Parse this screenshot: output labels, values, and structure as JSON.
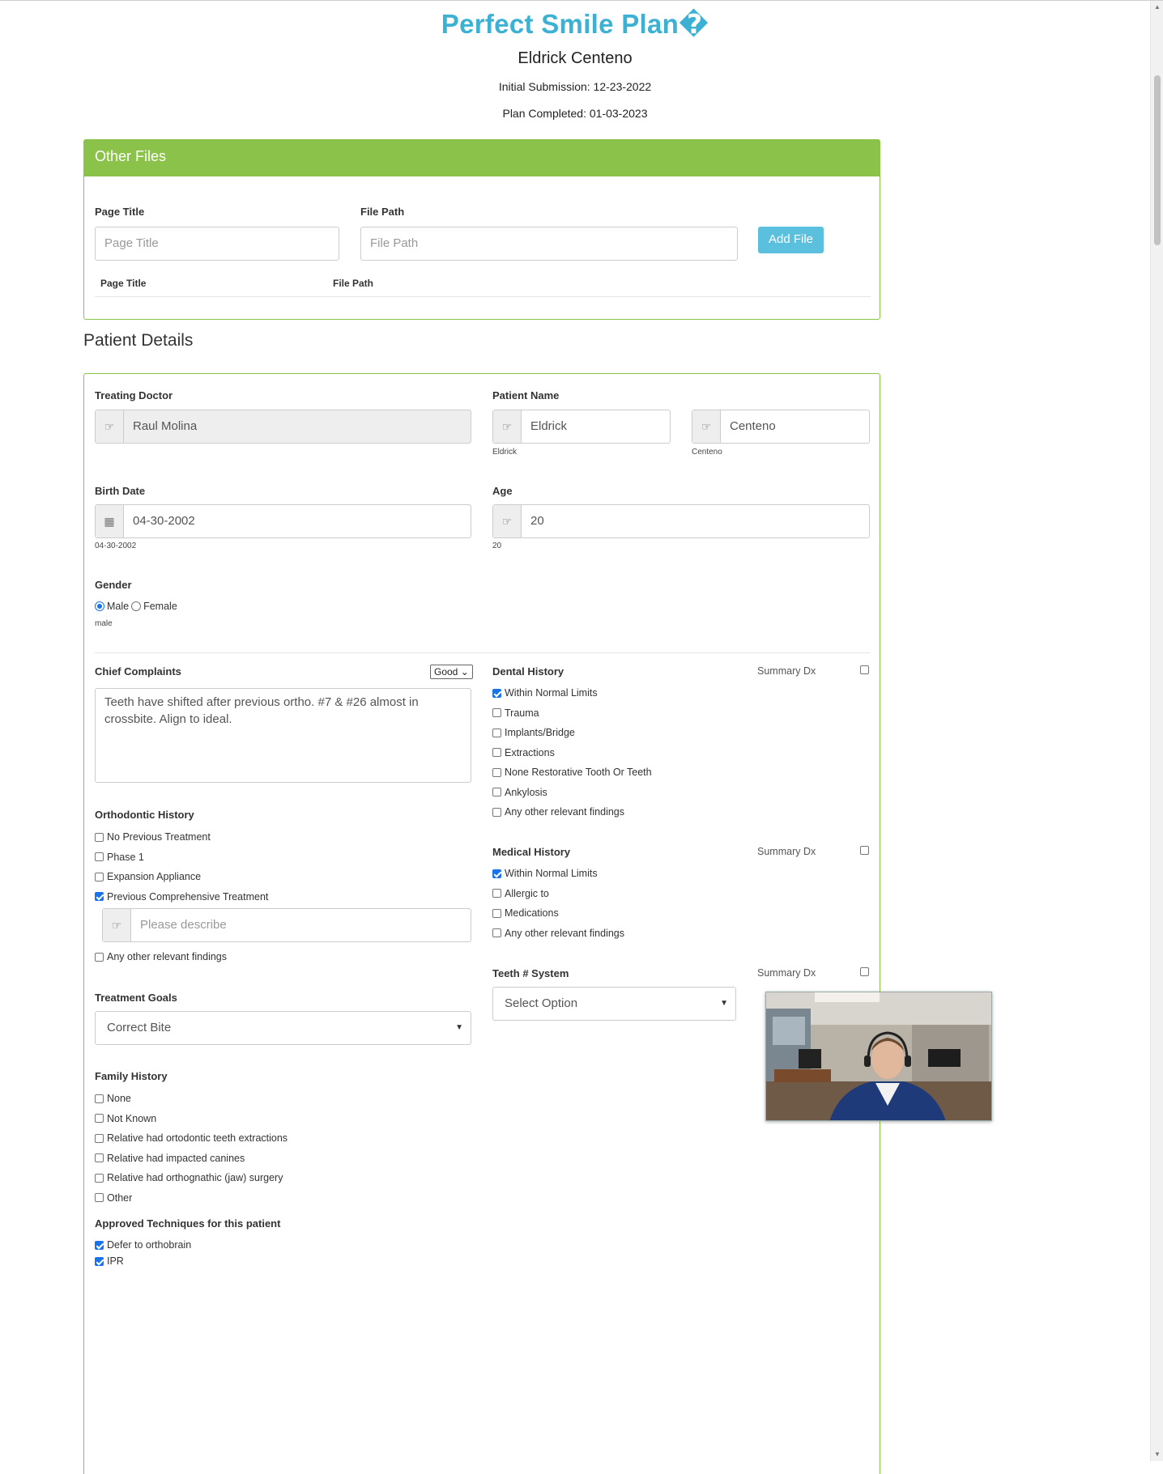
{
  "header": {
    "title": "Perfect Smile Plan",
    "title_suffix": "�",
    "patient_name": "Eldrick Centeno",
    "initial_submission": "Initial Submission: 12-23-2022",
    "plan_completed": "Plan Completed: 01-03-2023"
  },
  "other_files": {
    "heading": "Other Files",
    "page_title_label": "Page Title",
    "page_title_placeholder": "Page Title",
    "file_path_label": "File Path",
    "file_path_placeholder": "File Path",
    "add_button": "Add File",
    "table_headers": [
      "Page Title",
      "File Path"
    ]
  },
  "patient_details": {
    "heading": "Patient Details",
    "treating_doctor_label": "Treating Doctor",
    "treating_doctor": "Raul Molina",
    "patient_name_label": "Patient Name",
    "first_name": "Eldrick",
    "last_name": "Centeno",
    "first_name_hint": "Eldrick",
    "last_name_hint": "Centeno",
    "birth_date_label": "Birth Date",
    "birth_date": "04-30-2002",
    "birth_date_hint": "04-30-2002",
    "age_label": "Age",
    "age": "20",
    "age_hint": "20",
    "gender_label": "Gender",
    "gender_options": [
      "Male",
      "Female"
    ],
    "gender_selected": "Male",
    "gender_hint": "male"
  },
  "chief_complaints": {
    "label": "Chief Complaints",
    "rating": "Good",
    "text": "Teeth have shifted after previous ortho. #7 & #26 almost in crossbite. Align to ideal."
  },
  "orthodontic_history": {
    "label": "Orthodontic History",
    "items": [
      {
        "label": "No Previous Treatment",
        "checked": false
      },
      {
        "label": "Phase 1",
        "checked": false
      },
      {
        "label": "Expansion Appliance",
        "checked": false
      },
      {
        "label": "Previous Comprehensive Treatment",
        "checked": true
      }
    ],
    "describe_placeholder": "Please describe",
    "other": {
      "label": "Any other relevant findings",
      "checked": false
    }
  },
  "treatment_goals": {
    "label": "Treatment Goals",
    "value": "Correct Bite"
  },
  "family_history": {
    "label": "Family History",
    "items": [
      {
        "label": "None",
        "checked": false
      },
      {
        "label": "Not Known",
        "checked": false
      },
      {
        "label": "Relative had ortodontic teeth extractions",
        "checked": false
      },
      {
        "label": "Relative had impacted canines",
        "checked": false
      },
      {
        "label": "Relative had orthognathic (jaw) surgery",
        "checked": false
      },
      {
        "label": "Other",
        "checked": false
      }
    ]
  },
  "approved_techniques": {
    "label": "Approved Techniques for this patient",
    "items": [
      {
        "label": "Defer to orthobrain",
        "checked": true
      },
      {
        "label": "IPR",
        "checked": true
      }
    ]
  },
  "dental_history": {
    "label": "Dental History",
    "summary": "Summary Dx",
    "items": [
      {
        "label": "Within Normal Limits",
        "checked": true
      },
      {
        "label": "Trauma",
        "checked": false
      },
      {
        "label": "Implants/Bridge",
        "checked": false
      },
      {
        "label": "Extractions",
        "checked": false
      },
      {
        "label": "None Restorative Tooth Or Teeth",
        "checked": false
      },
      {
        "label": "Ankylosis",
        "checked": false
      },
      {
        "label": "Any other relevant findings",
        "checked": false
      }
    ]
  },
  "medical_history": {
    "label": "Medical History",
    "summary": "Summary Dx",
    "items": [
      {
        "label": "Within Normal Limits",
        "checked": true
      },
      {
        "label": "Allergic to",
        "checked": false
      },
      {
        "label": "Medications",
        "checked": false
      },
      {
        "label": "Any other relevant findings",
        "checked": false
      }
    ]
  },
  "teeth_system": {
    "label": "Teeth # System",
    "summary": "Summary Dx",
    "value": "Select Option"
  },
  "colors": {
    "accent": "#3db1d4",
    "panel_green": "#8bc34a",
    "button_blue": "#5bc0de",
    "check_blue": "#1a73e8"
  }
}
